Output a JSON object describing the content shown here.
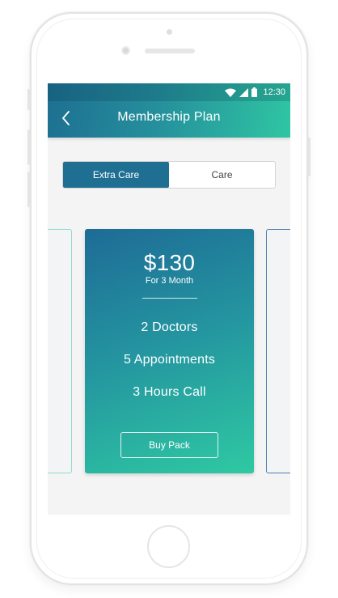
{
  "status_bar": {
    "time": "12:30",
    "icons": [
      "wifi-icon",
      "signal-icon",
      "battery-icon"
    ]
  },
  "header": {
    "title": "Membership Plan",
    "back_icon": "chevron-left-icon"
  },
  "tabs": [
    {
      "label": "Extra Care",
      "selected": true
    },
    {
      "label": "Care",
      "selected": false
    }
  ],
  "plan": {
    "price": "$130",
    "period": "For 3 Month",
    "features": [
      "2 Doctors",
      "5 Appointments",
      "3 Hours Call"
    ],
    "cta_label": "Buy Pack"
  },
  "colors": {
    "gradient_start": "#1e6b96",
    "gradient_end": "#2fc9a2",
    "accent": "#1f6f93",
    "background": "#f4f4f5"
  }
}
